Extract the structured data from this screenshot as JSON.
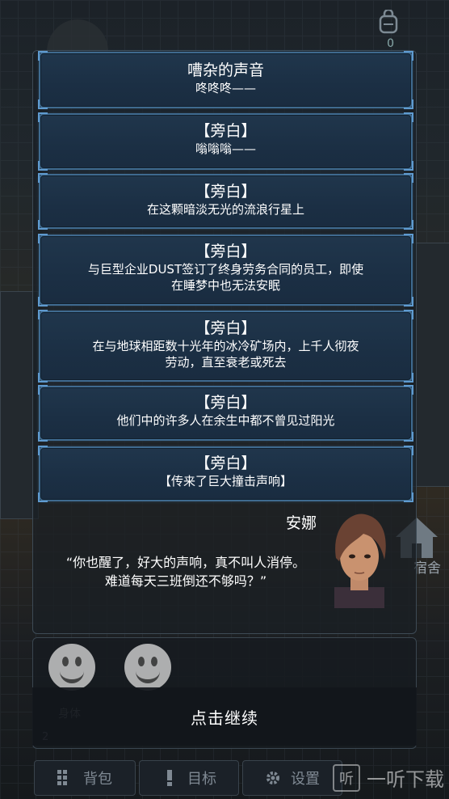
{
  "dialog_log": [
    {
      "title": "嘈杂的声音",
      "lines": [
        "咚咚咚——"
      ]
    },
    {
      "title": "【旁白】",
      "lines": [
        "嗡嗡嗡——"
      ]
    },
    {
      "title": "【旁白】",
      "lines": [
        "在这颗暗淡无光的流浪行星上"
      ]
    },
    {
      "title": "【旁白】",
      "lines": [
        "与巨型企业DUST签订了终身劳务合同的员工，即使",
        "在睡梦中也无法安眠"
      ]
    },
    {
      "title": "【旁白】",
      "lines": [
        "在与地球相距数十光年的冰冷矿场内，上千人彻夜",
        "劳动，直至衰老或死去"
      ]
    },
    {
      "title": "【旁白】",
      "lines": [
        "他们中的许多人在余生中都不曾见过阳光"
      ]
    },
    {
      "title": "【旁白】",
      "lines": [
        "【传来了巨大撞击声响】"
      ]
    }
  ],
  "current": {
    "speaker": "安娜",
    "quote_line1": "“你也醒了，好大的声响，真不叫人消停。",
    "quote_line2": "难道每天三班倒还不够吗？”"
  },
  "stats": {
    "label": "身体",
    "value": "2"
  },
  "continue_label": "点击继续",
  "background": {
    "bag_count": "0",
    "dorm_label": "宿舍"
  },
  "nav": {
    "bag": "背包",
    "goal": "目标",
    "settings": "设置"
  },
  "watermark": {
    "icon_char": "听",
    "text": "一听下载"
  },
  "colors": {
    "entry_border": "#3f6a8f",
    "entry_bg": "#1b2f44"
  }
}
